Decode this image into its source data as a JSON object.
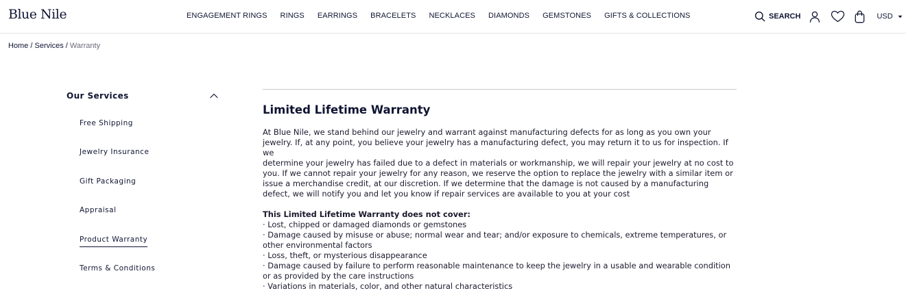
{
  "brand": {
    "logo": "Blue Nile"
  },
  "nav": {
    "items": [
      "ENGAGEMENT RINGS",
      "RINGS",
      "EARRINGS",
      "BRACELETS",
      "NECKLACES",
      "DIAMONDS",
      "GEMSTONES",
      "GIFTS & COLLECTIONS"
    ]
  },
  "utility": {
    "search_label": "SEARCH",
    "account_icon": "user-icon",
    "wishlist_icon": "heart-icon",
    "bag_icon": "shopping-bag-icon",
    "currency": "USD"
  },
  "breadcrumb": {
    "home": "Home",
    "separator": " / ",
    "services": "Services",
    "current": "Warranty"
  },
  "sidebar": {
    "title": "Our Services",
    "items": [
      "Free Shipping",
      "Jewelry Insurance",
      "Gift Packaging",
      "Appraisal",
      "Product Warranty",
      "Terms & Conditions"
    ],
    "active_item": "Product Warranty"
  },
  "content": {
    "title": "Limited Lifetime Warranty",
    "lines": [
      "At Blue Nile, we stand behind our jewelry and warrant against manufacturing defects for as long as you own your",
      "jewelry. If, at any point, you believe your jewelry has a manufacturing defect, you may return it to us for inspection. If we",
      "determine your jewelry has failed due to a defect in materials or workmanship, we will repair your jewelry at no cost to",
      "you. If we cannot repair your jewelry for any reason, we reserve the option to replace the jewelry with a similar item or",
      "issue a merchandise credit, at our discretion. If we determine that the damage is not caused by a manufacturing",
      "defect, we will notify you and let you know if repair services are available to you at your cost"
    ],
    "exclusions_heading": "This Limited Lifetime Warranty does not cover:",
    "exclusion_lines": [
      "· Lost, chipped or damaged diamonds or gemstones",
      "· Damage caused by misuse or abuse; normal wear and tear; and/or exposure to chemicals, extreme temperatures, or",
      "other environmental factors",
      "· Loss, theft, or mysterious disappearance",
      "· Damage caused by failure to perform reasonable maintenance to keep the jewelry in a usable and wearable condition",
      "or as provided by the care instructions",
      "· Variations in materials, color, and other natural characteristics"
    ]
  },
  "colors": {
    "navy": "#0f1432",
    "divider": "#e6e6ea",
    "muted": "#6b6b7b"
  }
}
